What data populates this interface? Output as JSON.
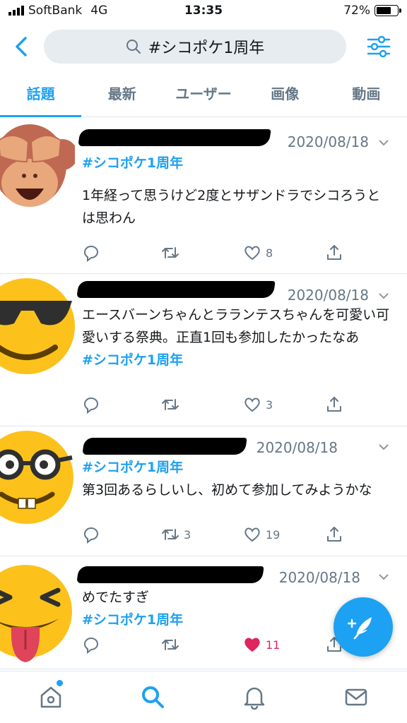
{
  "status_bar": {
    "carrier": "SoftBank",
    "network": "4G",
    "time": "13:35",
    "battery": "72%",
    "battery_level": 0.72
  },
  "search": {
    "query": "#シコポケ1周年",
    "back_icon": "chevron-left-icon",
    "filter_icon": "sliders-icon"
  },
  "tabs": [
    {
      "label": "話題",
      "active": true
    },
    {
      "label": "最新",
      "active": false
    },
    {
      "label": "ユーザー",
      "active": false
    },
    {
      "label": "画像",
      "active": false
    },
    {
      "label": "動画",
      "active": false
    }
  ],
  "tweets": [
    {
      "avatar": "see-no-evil-monkey",
      "date": "2020/08/18",
      "hashtag": "#シコポケ1周年",
      "text": "1年経って思うけど2度とサザンドラでシコろうとは思わん",
      "replies": "",
      "retweets": "",
      "likes": "8",
      "liked": false
    },
    {
      "avatar": "sunglasses-face",
      "date": "2020/08/18",
      "text": "エースバーンちゃんとラランテスちゃんを可愛い可愛いする祭典。正直1回も参加したかったなあ",
      "hashtag": "#シコポケ1周年",
      "replies": "",
      "retweets": "",
      "likes": "3",
      "liked": false
    },
    {
      "avatar": "nerd-face",
      "date": "2020/08/18",
      "hashtag": "#シコポケ1周年",
      "text": "第3回あるらしいし、初めて参加してみようかな",
      "replies": "",
      "retweets": "3",
      "likes": "19",
      "liked": false
    },
    {
      "avatar": "squinting-tongue-face",
      "date": "2020/08/18",
      "text": "めでたすぎ",
      "hashtag": "#シコポケ1周年",
      "replies": "",
      "retweets": "",
      "likes": "11",
      "liked": true
    }
  ],
  "fab": {
    "icon": "compose-feather-icon"
  },
  "bottom_nav": [
    {
      "icon": "home-icon",
      "active": false,
      "badge": true
    },
    {
      "icon": "search-icon",
      "active": true,
      "badge": false
    },
    {
      "icon": "bell-icon",
      "active": false,
      "badge": false
    },
    {
      "icon": "mail-icon",
      "active": false,
      "badge": false
    }
  ],
  "colors": {
    "accent": "#1da1f2",
    "secondary_text": "#657786",
    "like_active": "#e0245e",
    "search_bg": "#e6ecf0"
  }
}
